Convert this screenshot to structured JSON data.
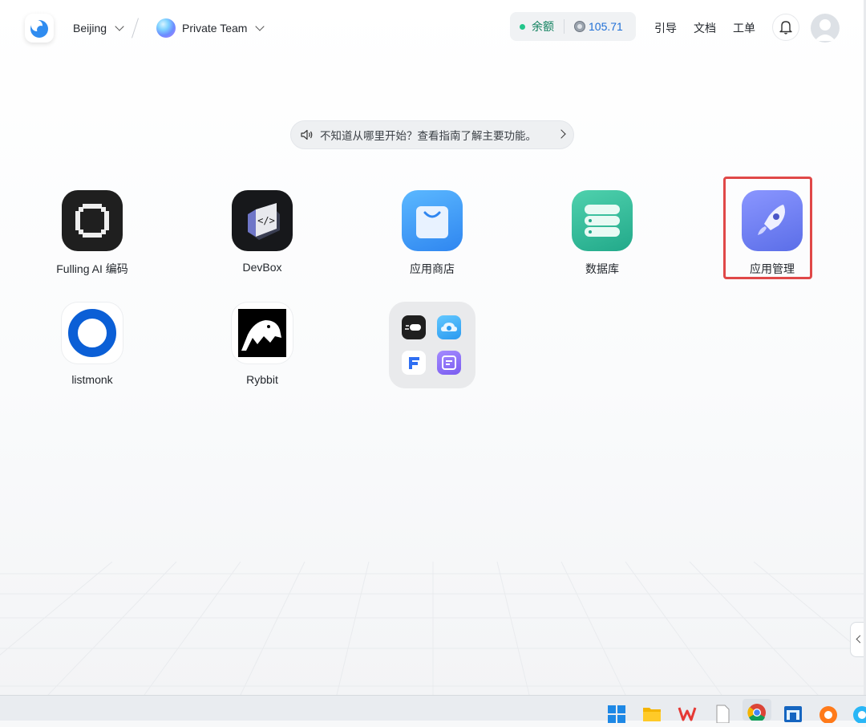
{
  "header": {
    "region": "Beijing",
    "team": "Private Team",
    "balance_label": "余额",
    "balance_value": "105.71",
    "nav": [
      "引导",
      "文档",
      "工单"
    ]
  },
  "banner": {
    "text": "不知道从哪里开始？查看指南了解主要功能。"
  },
  "apps": [
    {
      "label": "Fulling AI 编码",
      "icon": "fulling-ai-icon"
    },
    {
      "label": "DevBox",
      "icon": "devbox-icon"
    },
    {
      "label": "应用商店",
      "icon": "app-store-bag-icon"
    },
    {
      "label": "数据库",
      "icon": "database-icon"
    },
    {
      "label": "应用管理",
      "icon": "rocket-icon",
      "highlighted": true
    },
    {
      "label": "listmonk",
      "icon": "listmonk-ring-icon"
    },
    {
      "label": "Rybbit",
      "icon": "rybbit-frog-icon"
    }
  ],
  "folder": {
    "icons": [
      "speed-icon",
      "cloud-icon",
      "f-logo-icon",
      "form-icon"
    ]
  },
  "colors": {
    "highlight": "#e04848",
    "balance_dot": "#22c58b",
    "balance_value": "#1f6fd6"
  },
  "taskbar": {
    "icons": [
      "windows-start-icon",
      "file-explorer-icon",
      "wps-icon",
      "blank-file-icon",
      "chrome-icon",
      "app-window-icon",
      "orange-app-icon",
      "browser-icon"
    ]
  }
}
